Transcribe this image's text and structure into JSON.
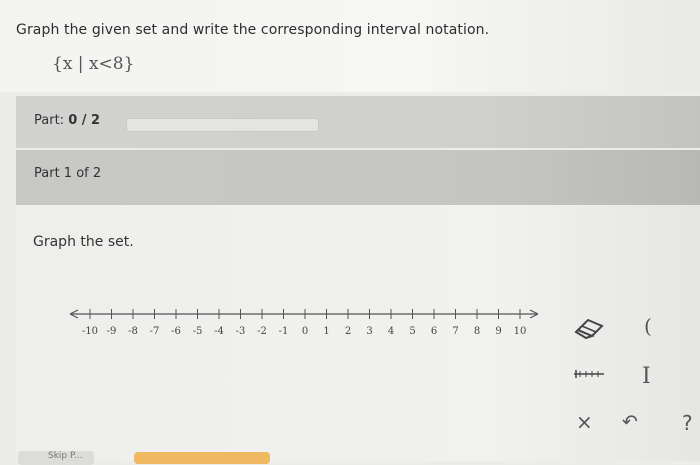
{
  "question": {
    "prompt": "Graph the given set and write the corresponding interval notation.",
    "set_notation": "{x | x<8}"
  },
  "part_progress": {
    "label": "Part:",
    "value": "0 / 2",
    "fraction": 0
  },
  "part_indicator": {
    "label": "Part 1 of 2"
  },
  "instruction": "Graph the set.",
  "number_line": {
    "ticks": [
      "-10",
      "-9",
      "-8",
      "-7",
      "-6",
      "-5",
      "-4",
      "-3",
      "-2",
      "-1",
      "0",
      "1",
      "2",
      "3",
      "4",
      "5",
      "6",
      "7",
      "8",
      "9",
      "10"
    ]
  },
  "toolbar": {
    "icons": [
      "eraser-icon",
      "left-paren-icon",
      "bracket-segment-icon",
      "bar-icon",
      "clear-icon",
      "undo-icon",
      "help-icon"
    ],
    "paren_glyph": "(",
    "bar_glyph": "I",
    "clear_glyph": "×",
    "undo_glyph": "↶",
    "help_glyph": "?"
  },
  "footer": {
    "skip_label": "Skip P..."
  }
}
